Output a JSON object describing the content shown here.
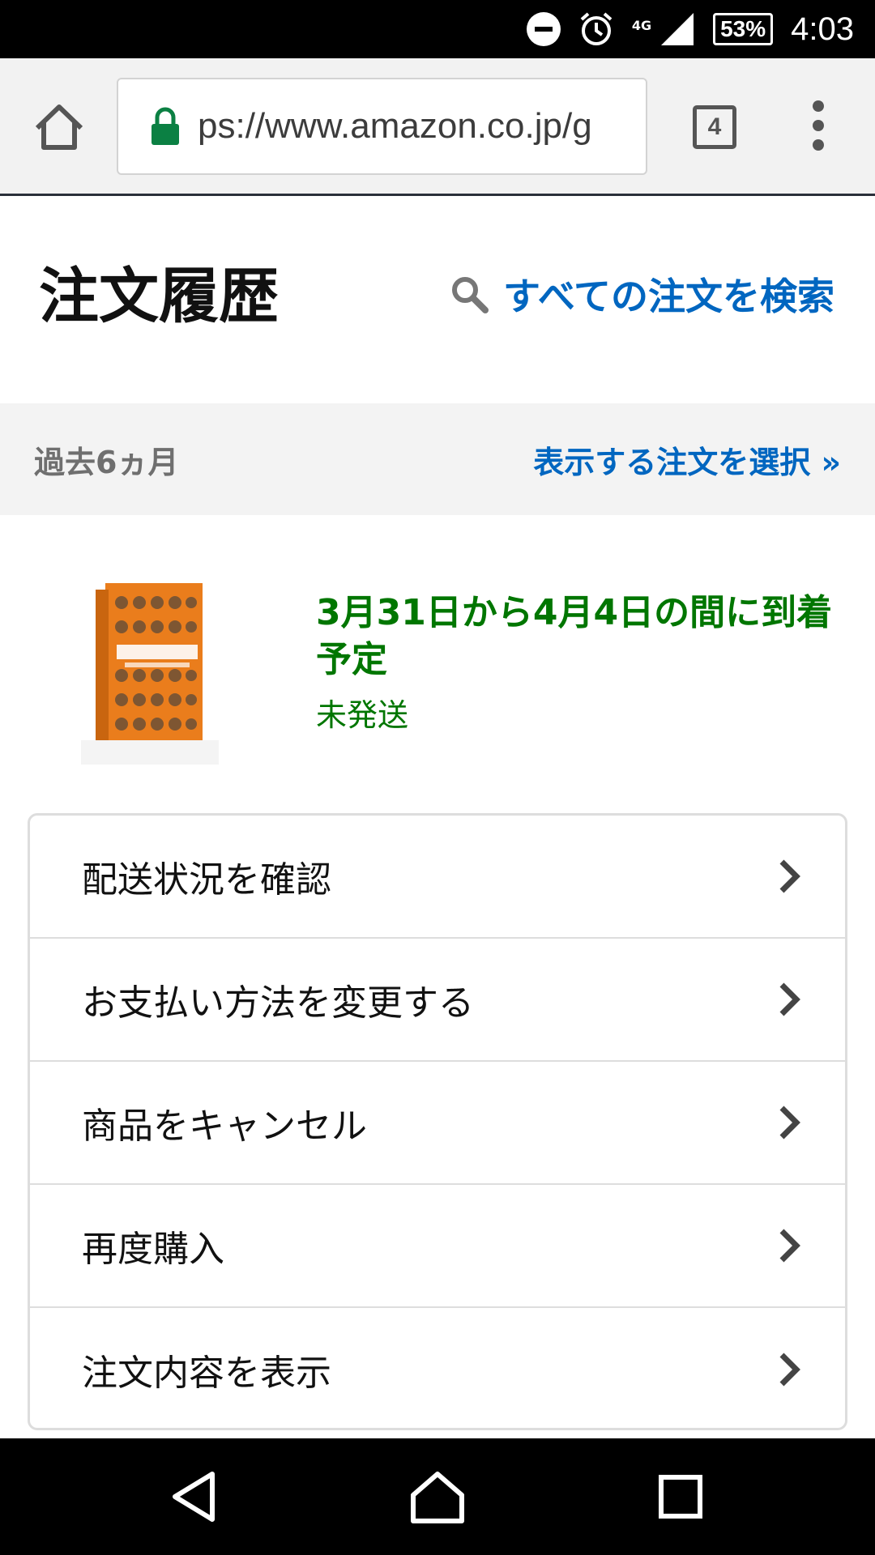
{
  "status_bar": {
    "network": "4G",
    "battery": "53%",
    "time": "4:03",
    "icons": [
      "do-not-disturb-icon",
      "alarm-icon",
      "signal-icon",
      "battery-icon"
    ]
  },
  "browser": {
    "url": "ps://www.amazon.co.jp/g",
    "tab_count": "4",
    "icons": [
      "home-icon",
      "lock-icon",
      "tabs-icon",
      "more-vert-icon"
    ]
  },
  "page": {
    "title": "注文履歴",
    "search_link": "すべての注文を検索"
  },
  "filter": {
    "period": "過去6ヵ月",
    "select_label": "表示する注文を選択 »"
  },
  "order": {
    "delivery_date": "3月31日から4月4日の間に到着予定",
    "status": "未発送"
  },
  "actions": [
    {
      "label": "配送状況を確認"
    },
    {
      "label": "お支払い方法を変更する"
    },
    {
      "label": "商品をキャンセル"
    },
    {
      "label": "再度購入"
    },
    {
      "label": "注文内容を表示"
    }
  ],
  "colors": {
    "link_blue": "#0066c0",
    "delivery_green": "#007600",
    "lock_green": "#0b8043"
  }
}
